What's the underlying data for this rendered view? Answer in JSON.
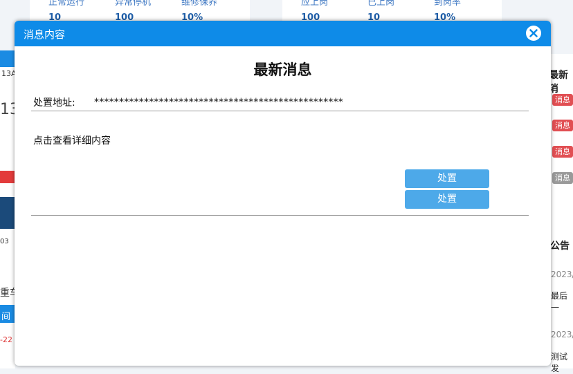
{
  "background": {
    "stats_left": [
      {
        "label": "正常运行",
        "value": "10"
      },
      {
        "label": "异常停机",
        "value": "100"
      },
      {
        "label": "维修保养",
        "value": "10%"
      }
    ],
    "stats_right": [
      {
        "label": "应上岗",
        "value": "100"
      },
      {
        "label": "已上岗",
        "value": "10"
      },
      {
        "label": "到岗率",
        "value": "10%"
      }
    ],
    "left_fragments": [
      "13A",
      "13",
      "03",
      "重车",
      "间",
      "-22"
    ],
    "right_fragments": {
      "news_heading": "最新消",
      "tags": [
        "消息",
        "消息",
        "消息",
        "消息"
      ],
      "notice_heading": "公告",
      "date_1": "2023/",
      "item_1": "最后一",
      "date_2": "2023/",
      "item_2": "测试发"
    }
  },
  "modal": {
    "title": "消息内容",
    "heading": "最新消息",
    "address_label": "处置地址:",
    "address_value": "**************************************************",
    "detail_link": "点击查看详细内容",
    "buttons": [
      "处置",
      "处置"
    ]
  },
  "colors": {
    "header_blue": "#0e8be8",
    "button_blue": "#4da9e9",
    "tag_red": "#e14f53",
    "tag_gray": "#9a9a9a"
  }
}
